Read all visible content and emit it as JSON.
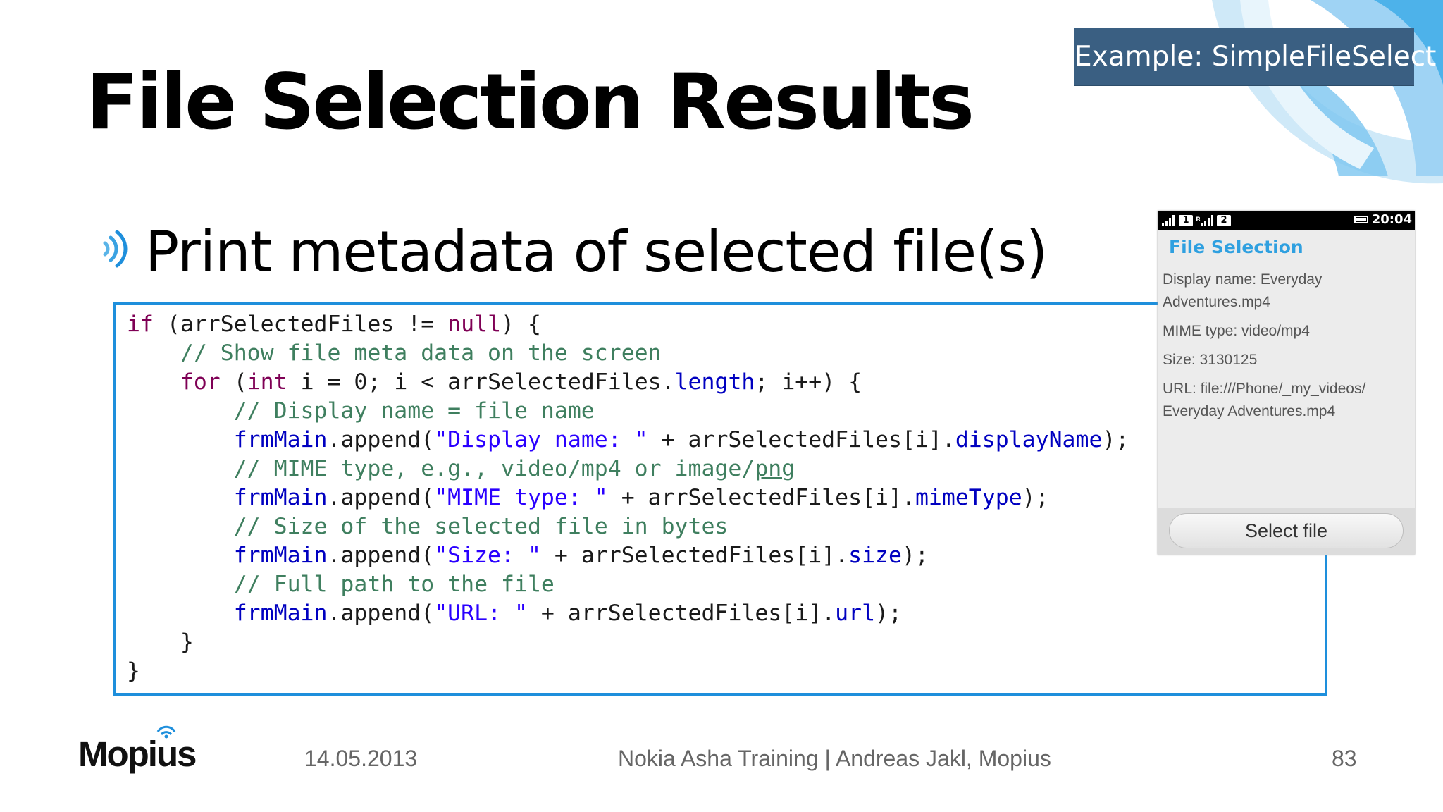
{
  "slide": {
    "title": "File Selection Results",
    "badge": "Example: SimpleFileSelect",
    "bullet": "Print metadata of selected file(s)",
    "colors": {
      "accent_blue": "#1e8fdc",
      "badge_bg": "#3a5f82",
      "light_blue": "#2fa0e0"
    }
  },
  "code": {
    "language": "javascript",
    "lines": [
      "if (arrSelectedFiles != null) {",
      "    // Show file meta data on the screen",
      "    for (int i = 0; i < arrSelectedFiles.length; i++) {",
      "        // Display name = file name",
      "        frmMain.append(\"Display name: \" + arrSelectedFiles[i].displayName);",
      "        // MIME type, e.g., video/mp4 or image/png",
      "        frmMain.append(\"MIME type: \" + arrSelectedFiles[i].mimeType);",
      "        // Size of the selected file in bytes",
      "        frmMain.append(\"Size: \" + arrSelectedFiles[i].size);",
      "        // Full path to the file",
      "        frmMain.append(\"URL: \" + arrSelectedFiles[i].url);",
      "    }",
      "}"
    ]
  },
  "phone": {
    "status": {
      "icons": [
        "signal-icon",
        "sim-1-icon",
        "roaming-signal-icon",
        "sim-2-icon"
      ],
      "sim1": "1",
      "sim2": "2",
      "battery": "battery-icon",
      "time": "20:04"
    },
    "header": "File Selection",
    "lines": [
      "Display name: Everyday Adventures.mp4",
      "MIME type: video/mp4",
      "Size: 3130125",
      "URL: file:///Phone/_my_videos/ Everyday Adventures.mp4"
    ],
    "button": "Select file"
  },
  "footer": {
    "logo": "Mopius",
    "date": "14.05.2013",
    "center": "Nokia Asha Training | Andreas Jakl, Mopius",
    "page": "83"
  }
}
